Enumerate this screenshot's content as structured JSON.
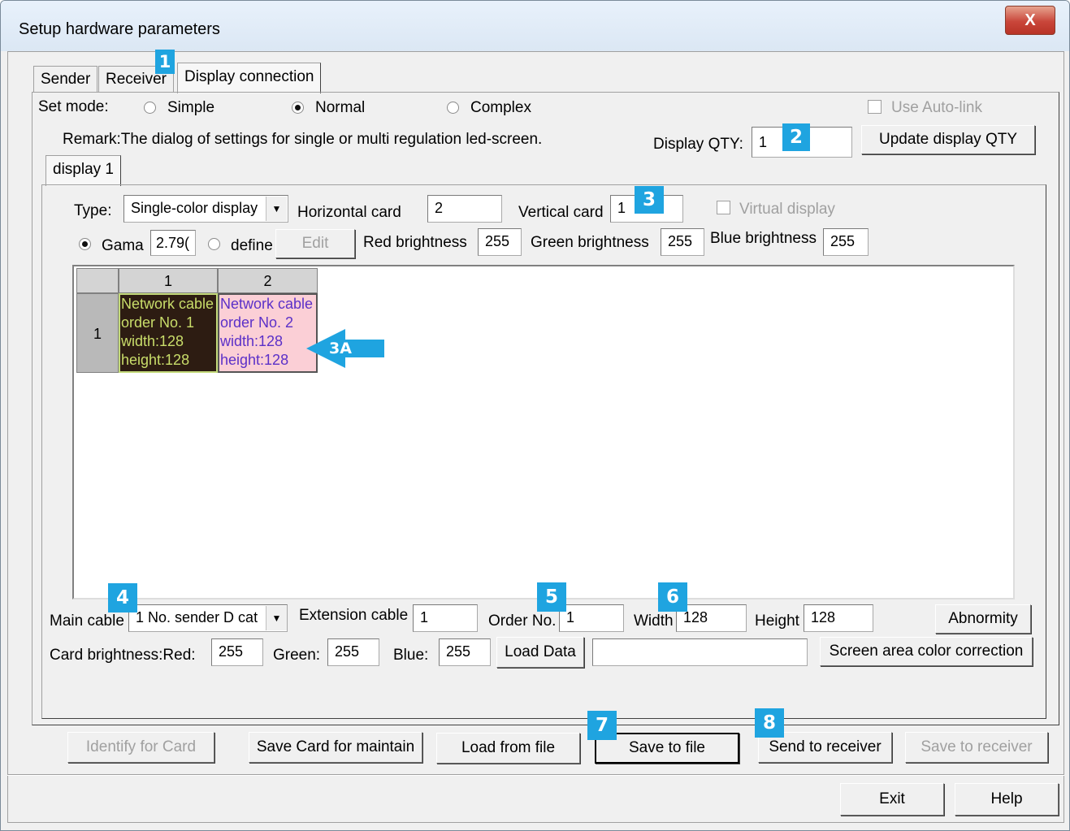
{
  "window": {
    "title": "Setup hardware parameters",
    "close_label": "X"
  },
  "tabs": [
    {
      "label": "Sender"
    },
    {
      "label": "Receiver"
    },
    {
      "label": "Display connection"
    }
  ],
  "set_mode": {
    "label": "Set mode:",
    "options": [
      {
        "label": "Simple",
        "checked": false
      },
      {
        "label": "Normal",
        "checked": true
      },
      {
        "label": "Complex",
        "checked": false
      }
    ]
  },
  "use_auto_link": {
    "label": "Use Auto-link",
    "checked": false,
    "enabled": false
  },
  "remark": "Remark:The dialog of settings for single or multi  regulation led-screen.",
  "display_qty": {
    "label": "Display QTY:",
    "value": "1",
    "update_button": "Update display QTY"
  },
  "display_tab": {
    "label": "display 1"
  },
  "type": {
    "label": "Type:",
    "value": "Single-color display"
  },
  "horizontal_card": {
    "label": "Horizontal card",
    "value": "2"
  },
  "vertical_card": {
    "label": "Vertical card",
    "value": "1"
  },
  "virtual_display": {
    "label": "Virtual display",
    "checked": false,
    "enabled": false
  },
  "gamma": {
    "gama_label": "Gama",
    "gama_value": "2.79(",
    "define_label": "define",
    "edit_button": "Edit"
  },
  "brightness": {
    "red_label": "Red brightness",
    "red_value": "255",
    "green_label": "Green brightness",
    "green_value": "255",
    "blue_label": "Blue brightness",
    "blue_value": "255"
  },
  "grid": {
    "col_headers": [
      "1",
      "2"
    ],
    "row_headers": [
      "1"
    ],
    "cells": [
      {
        "lines": [
          "Network cable",
          "order No. 1",
          "width:128",
          "height:128"
        ]
      },
      {
        "lines": [
          "Network cable",
          "order No. 2",
          "width:128",
          "height:128"
        ]
      }
    ]
  },
  "cable": {
    "main_label": "Main cable",
    "main_value": "1 No. sender D cat",
    "extension_label": "Extension cable",
    "extension_value": "1",
    "order_label": "Order No.",
    "order_value": "1",
    "width_label": "Width",
    "width_value": "128",
    "height_label": "Height",
    "height_value": "128",
    "abnormity_button": "Abnormity"
  },
  "card_brightness": {
    "red_label": "Card brightness:Red:",
    "red_value": "255",
    "green_label": "Green:",
    "green_value": "255",
    "blue_label": "Blue:",
    "blue_value": "255",
    "load_data_button": "Load Data",
    "load_data_path": "",
    "color_correction_button": "Screen area color correction"
  },
  "actions": {
    "identify": "Identify for Card",
    "save_card": "Save Card for maintain",
    "load_file": "Load from file",
    "save_file": "Save to file",
    "send_receiver": "Send to receiver",
    "save_receiver": "Save to receiver"
  },
  "footer": {
    "exit": "Exit",
    "help": "Help"
  },
  "annotations": {
    "m1": "1",
    "m2": "2",
    "m3": "3",
    "m3a": "3A",
    "m4": "4",
    "m5": "5",
    "m6": "6",
    "m7": "7",
    "m8": "8",
    "color": "#1fa4e0"
  }
}
